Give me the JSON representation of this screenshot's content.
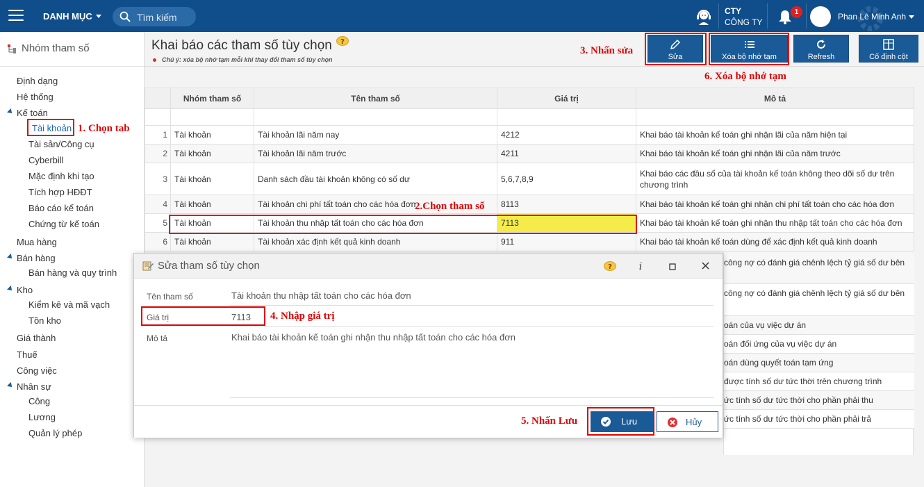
{
  "topbar": {
    "menu_label": "DANH MỤC",
    "search_placeholder": "Tìm kiếm",
    "company_line1": "CTY",
    "company_line2": "CÔNG TY",
    "notification_count": "1",
    "user_name": "Phan Lê Minh Anh"
  },
  "sidebar": {
    "title": "Nhóm tham số",
    "items": [
      {
        "label": "Định dạng"
      },
      {
        "label": "Hệ thống"
      },
      {
        "label": "Kế toán"
      },
      {
        "label": "Tài khoản"
      },
      {
        "label": "Tài sản/Công cụ"
      },
      {
        "label": "Cyberbill"
      },
      {
        "label": "Mặc định khi tạo"
      },
      {
        "label": "Tích hợp HĐĐT"
      },
      {
        "label": "Báo cáo kế toán"
      },
      {
        "label": "Chứng từ kế toán"
      },
      {
        "label": "Mua hàng"
      },
      {
        "label": "Bán hàng"
      },
      {
        "label": "Bán hàng và quy trình"
      },
      {
        "label": "Kho"
      },
      {
        "label": "Kiểm kê và mã vạch"
      },
      {
        "label": "Tồn kho"
      },
      {
        "label": "Giá thành"
      },
      {
        "label": "Thuế"
      },
      {
        "label": "Công việc"
      },
      {
        "label": "Nhân sự"
      },
      {
        "label": "Công"
      },
      {
        "label": "Lương"
      },
      {
        "label": "Quản lý phép"
      }
    ]
  },
  "header": {
    "title": "Khai báo các tham số tùy chọn",
    "note": "Chú ý: xóa bộ nhớ tạm mỗi khi thay đổi tham số tùy chọn"
  },
  "toolbar": {
    "edit_label": "Sửa",
    "clear_cache_label": "Xóa bộ nhớ tạm",
    "refresh_label": "Refresh",
    "fix_column_label": "Cố định cột"
  },
  "annotations": {
    "step1": "1. Chọn tab",
    "step2": "2.Chọn tham số",
    "step3": "3. Nhấn sửa",
    "step4": "4. Nhập giá trị",
    "step5": "5. Nhấn Lưu",
    "step6": "6. Xóa bộ nhớ tạm"
  },
  "grid": {
    "columns": [
      "Nhóm tham số",
      "Tên tham số",
      "Giá trị",
      "Mô tả"
    ],
    "rows": [
      {
        "num": "1",
        "group": "Tài khoản",
        "name": "Tài khoản lãi năm nay",
        "value": "4212",
        "desc": "Khai báo tài khoản kế toán ghi nhận lãi của năm hiện tại"
      },
      {
        "num": "2",
        "group": "Tài khoản",
        "name": "Tài khoản lãi năm trước",
        "value": "4211",
        "desc": "Khai báo tài khoản kế toán ghi nhận lãi của năm trước"
      },
      {
        "num": "3",
        "group": "Tài khoản",
        "name": "Danh sách đầu tài khoản không có số dư",
        "value": "5,6,7,8,9",
        "desc": "Khai báo các đầu số của tài khoản kế toán không theo dõi số dư trên chương trình"
      },
      {
        "num": "4",
        "group": "Tài khoản",
        "name": "Tài khoản chi phí tất toán cho các hóa đơn",
        "value": "8113",
        "desc": "Khai báo tài khoản kế toán ghi nhận chi phí tất toán cho các hóa đơn"
      },
      {
        "num": "5",
        "group": "Tài khoản",
        "name": "Tài khoản thu nhập tất toán cho các hóa đơn",
        "value": "7113",
        "desc": "Khai báo tài khoản kế toán ghi nhận thu nhập tất toán cho các hóa đơn"
      },
      {
        "num": "6",
        "group": "Tài khoản",
        "name": "Tài khoản xác định kết quả kinh doanh",
        "value": "911",
        "desc": "Khai báo tài khoản kế toán dùng để xác định kết quả kinh doanh"
      }
    ],
    "partial_desc": [
      "công nợ có đánh giá chênh lệch tỷ giá số dư bên",
      "công nợ có đánh giá chênh lệch tỷ giá số dư bên",
      "oán của vụ việc dự án",
      "oán đối ứng của vụ việc dự án",
      "oán dùng quyết toán tạm ứng",
      "được tính số dư tức thời trên chương trình",
      "ức tính số dư tức thời cho phần phải thu",
      "ức tính số dư tức thời cho phần phải trả"
    ]
  },
  "dialog": {
    "title": "Sửa tham số tùy chọn",
    "name_label": "Tên tham số",
    "name_value": "Tài khoản thu nhập tất toán cho các hóa đơn",
    "value_label": "Giá trị",
    "value_value": "7113",
    "desc_label": "Mô tả",
    "desc_value": "Khai báo tài khoản kế toán ghi nhận thu nhập tất toán cho các hóa đơn",
    "save_label": "Lưu",
    "cancel_label": "Hủy"
  },
  "colors": {
    "topbar": "#0f4e8b",
    "primary_button": "#1a5a96",
    "highlight_cell": "#f5ec4c",
    "annotation_red": "#e00000"
  }
}
